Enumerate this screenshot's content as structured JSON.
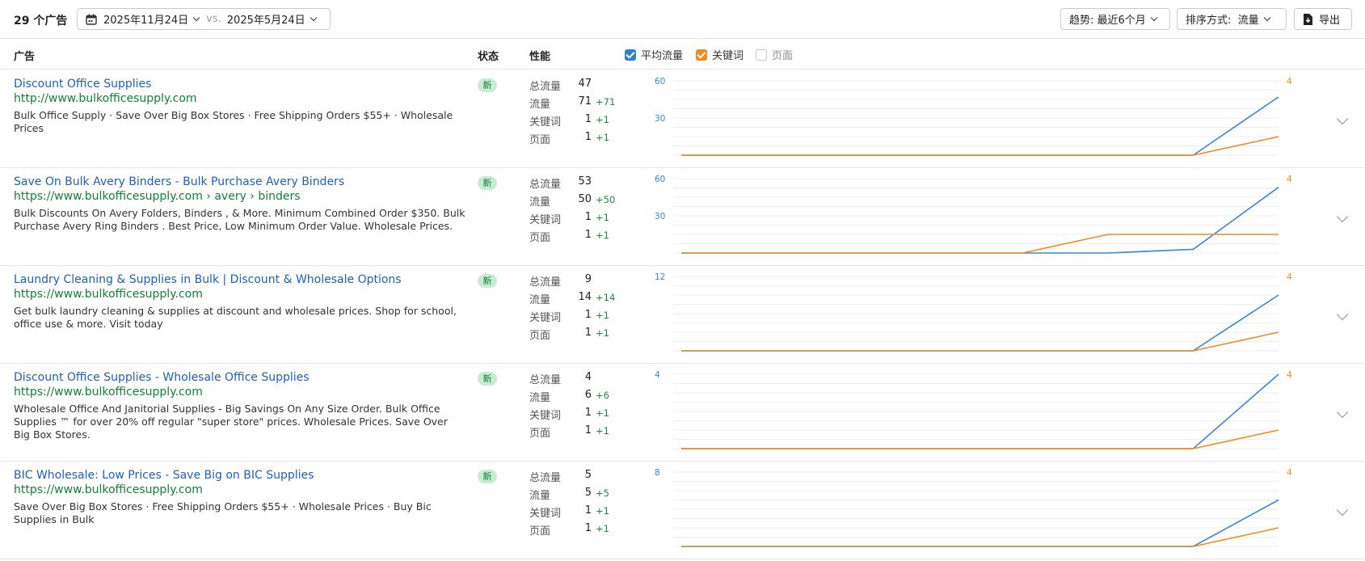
{
  "toolbar": {
    "ad_count": "29 个广告",
    "date_current": "2025年11月24日",
    "vs": "vs.",
    "date_compare": "2025年5月24日",
    "trend_label": "趋势: 最近6个月",
    "sort_label": "排序方式:  流量",
    "export_label": "导出"
  },
  "columns": {
    "ad": "广告",
    "status": "状态",
    "performance": "性能"
  },
  "legend": {
    "avg_traffic": "平均流量",
    "keywords": "关键词",
    "pages": "页面"
  },
  "colors": {
    "traffic_line": "#3b86d6",
    "keyword_line": "#f08c1f",
    "title_link": "#1f5fbf",
    "url_green": "#11813a"
  },
  "metric_labels": {
    "total_traffic": "总流量",
    "traffic": "流量",
    "keywords": "关键词",
    "pages": "页面"
  },
  "ads": [
    {
      "title": "Discount Office Supplies",
      "url": "http://www.bulkofficesupply.com",
      "description": "Bulk Office Supply · Save Over Big Box Stores · Free Shipping Orders $55+ · Wholesale Prices",
      "status": "新",
      "total_traffic": "47",
      "traffic": "71",
      "traffic_delta": "+71",
      "keywords": "1",
      "keywords_delta": "+1",
      "pages": "1",
      "pages_delta": "+1",
      "chart_data": {
        "type": "line",
        "y_left_ticks": [
          "60",
          "30"
        ],
        "y_left_max": 60,
        "y_right_ticks": [
          "4"
        ],
        "y_right_max": 4,
        "series": [
          {
            "values": [
              0,
              0,
              0,
              0,
              0,
              0,
              0,
              47
            ]
          },
          {
            "values": [
              0,
              0,
              0,
              0,
              0,
              0,
              0,
              1
            ]
          }
        ]
      }
    },
    {
      "title": "Save On Bulk Avery Binders - Bulk Purchase Avery Binders",
      "url": "https://www.bulkofficesupply.com › avery › binders",
      "description": "Bulk Discounts On Avery Folders, Binders , & More. Minimum Combined Order $350. Bulk Purchase Avery Ring Binders . Best Price, Low Minimum Order Value. Wholesale Prices.",
      "status": "新",
      "total_traffic": "53",
      "traffic": "50",
      "traffic_delta": "+50",
      "keywords": "1",
      "keywords_delta": "+1",
      "pages": "1",
      "pages_delta": "+1",
      "chart_data": {
        "type": "line",
        "y_left_ticks": [
          "60",
          "30"
        ],
        "y_left_max": 60,
        "y_right_ticks": [
          "4"
        ],
        "y_right_max": 4,
        "series": [
          {
            "values": [
              0,
              0,
              0,
              0,
              0,
              0,
              3,
              53
            ]
          },
          {
            "values": [
              0,
              0,
              0,
              0,
              0,
              1,
              1,
              1
            ]
          }
        ]
      }
    },
    {
      "title": "Laundry Cleaning & Supplies in Bulk | Discount & Wholesale Options",
      "url": "https://www.bulkofficesupply.com",
      "description": "Get bulk laundry cleaning & supplies at discount and wholesale prices. Shop for school, office use & more. Visit today",
      "status": "新",
      "total_traffic": "9",
      "traffic": "14",
      "traffic_delta": "+14",
      "keywords": "1",
      "keywords_delta": "+1",
      "pages": "1",
      "pages_delta": "+1",
      "chart_data": {
        "type": "line",
        "y_left_ticks": [
          "12"
        ],
        "y_left_max": 12,
        "y_right_ticks": [
          "4"
        ],
        "y_right_max": 4,
        "series": [
          {
            "values": [
              0,
              0,
              0,
              0,
              0,
              0,
              0,
              9
            ]
          },
          {
            "values": [
              0,
              0,
              0,
              0,
              0,
              0,
              0,
              1
            ]
          }
        ]
      }
    },
    {
      "title": "Discount Office Supplies - Wholesale Office Supplies",
      "url": "https://www.bulkofficesupply.com",
      "description": "Wholesale Office And Janitorial Supplies - Big Savings On Any Size Order. Bulk Office Supplies ™ for over 20% off regular \"super store\" prices. Wholesale Prices. Save Over Big Box Stores.",
      "status": "新",
      "total_traffic": "4",
      "traffic": "6",
      "traffic_delta": "+6",
      "keywords": "1",
      "keywords_delta": "+1",
      "pages": "1",
      "pages_delta": "+1",
      "chart_data": {
        "type": "line",
        "y_left_ticks": [
          "4"
        ],
        "y_left_max": 4,
        "y_right_ticks": [
          "4"
        ],
        "y_right_max": 4,
        "series": [
          {
            "values": [
              0,
              0,
              0,
              0,
              0,
              0,
              0,
              4
            ]
          },
          {
            "values": [
              0,
              0,
              0,
              0,
              0,
              0,
              0,
              1
            ]
          }
        ]
      }
    },
    {
      "title": "BIC Wholesale: Low Prices - Save Big on BIC Supplies",
      "url": "https://www.bulkofficesupply.com",
      "description": "Save Over Big Box Stores · Free Shipping Orders $55+ · Wholesale Prices · Buy Bic Supplies in Bulk",
      "status": "新",
      "total_traffic": "5",
      "traffic": "5",
      "traffic_delta": "+5",
      "keywords": "1",
      "keywords_delta": "+1",
      "pages": "1",
      "pages_delta": "+1",
      "chart_data": {
        "type": "line",
        "y_left_ticks": [
          "8"
        ],
        "y_left_max": 8,
        "y_right_ticks": [
          "4"
        ],
        "y_right_max": 4,
        "series": [
          {
            "values": [
              0,
              0,
              0,
              0,
              0,
              0,
              0,
              5
            ]
          },
          {
            "values": [
              0,
              0,
              0,
              0,
              0,
              0,
              0,
              1
            ]
          }
        ]
      }
    }
  ]
}
